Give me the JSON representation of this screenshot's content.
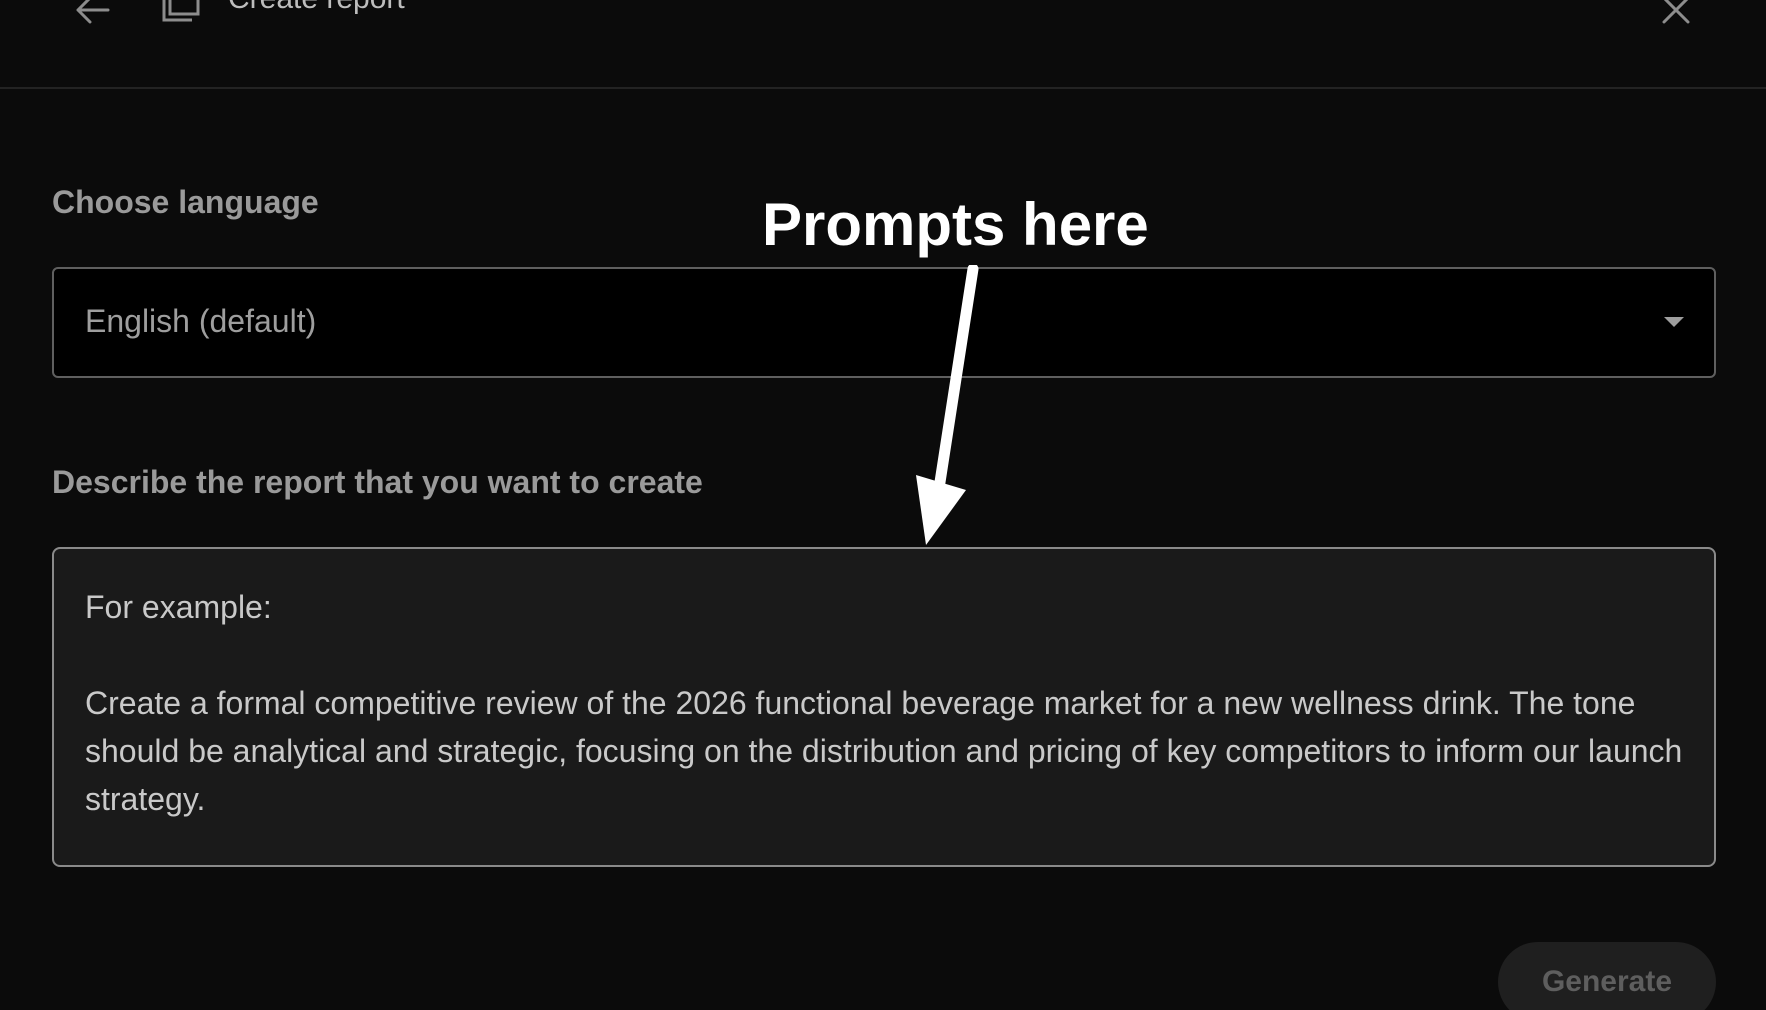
{
  "header": {
    "title": "Create report",
    "back_icon": "arrow-left-icon",
    "doc_icon": "document-copy-icon",
    "close_icon": "close-icon"
  },
  "language": {
    "label": "Choose language",
    "selected": "English (default)"
  },
  "description": {
    "label": "Describe the report that you want to create",
    "placeholder_heading": "For example:",
    "placeholder_body": "Create a formal competitive review of the 2026 functional beverage market for a new wellness drink. The tone should be analytical and strategic, focusing on the distribution and pricing of key competitors to inform our launch strategy."
  },
  "actions": {
    "generate_label": "Generate"
  },
  "annotation": {
    "text": "Prompts here"
  },
  "colors": {
    "background": "#0b0b0b",
    "field_bg": "#1a1a1a",
    "border": "#5f5f5f",
    "annotation": "#ffffff"
  }
}
